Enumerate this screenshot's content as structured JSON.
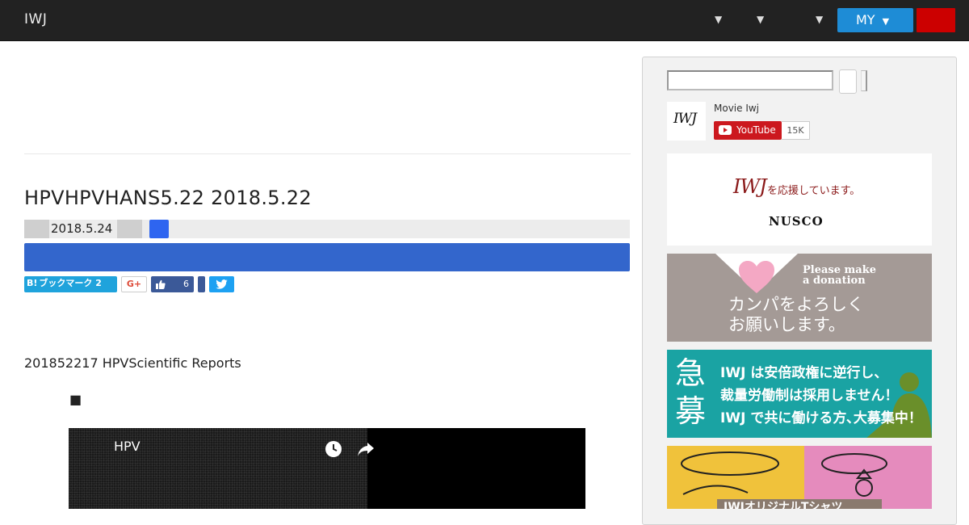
{
  "header": {
    "logo": "IWJ",
    "caret_symbol": "▼",
    "my_button_label": "MY",
    "colors": {
      "bar": "#222222",
      "my_button": "#1e8cd6",
      "red_button": "#cc0000"
    }
  },
  "article": {
    "title": "HPVHPVHANS5.22 2018.5.22",
    "date": "2018.5.24",
    "share": {
      "hatena_label": "ブックマーク",
      "hatena_prefix": "B!",
      "hatena_count": "2",
      "gplus_label": "G+",
      "facebook_count": "6"
    },
    "body_text": "201852217 HPVScientific Reports",
    "bullet": "■",
    "video": {
      "title": "HPV",
      "icons": [
        "clock-icon",
        "share-arrow-icon"
      ]
    }
  },
  "sidebar": {
    "youtube": {
      "channel_name": "Movie Iwj",
      "logo_text": "IWJ",
      "subscribe_label": "YouTube",
      "subscriber_count": "15K"
    },
    "ads": {
      "nusco": {
        "brand": "IWJ",
        "tagline": "を応援しています。",
        "sponsor": "NUSCO"
      },
      "donate": {
        "english_line1": "Please make",
        "english_line2": "a donation",
        "japanese_line1": "カンパをよろしく",
        "japanese_line2": "お願いします。"
      },
      "recruit": {
        "big_char1": "急",
        "big_char2": "募",
        "line1": "IWJ は安倍政権に逆行し、",
        "line2": "裁量労働制は採用しません！",
        "line3": "IWJ で共に働ける方､大募集中！"
      },
      "shirt": {
        "caption": "IWJオリジナルTシャツ"
      }
    }
  }
}
